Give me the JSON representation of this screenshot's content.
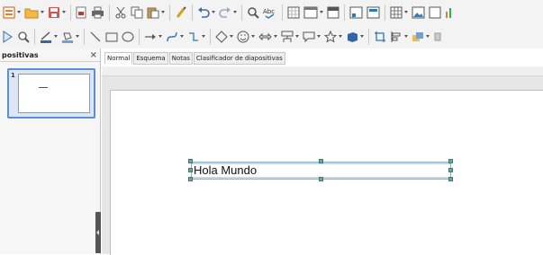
{
  "toolbar1": {
    "icons": [
      "presentation-icon",
      "open-folder-icon",
      "save-icon",
      "export-pdf-icon",
      "print-icon",
      "cut-icon",
      "copy-icon",
      "paste-icon",
      "clone-formatting-icon",
      "undo-icon",
      "redo-icon",
      "find-replace-icon",
      "spelling-icon",
      "grid-icon",
      "slide-layout-icon",
      "master-slide-icon",
      "display-views-icon",
      "table-icon",
      "image-icon",
      "media-icon"
    ]
  },
  "toolbar2": {
    "icons": [
      "sidebar-icon",
      "zoom-icon",
      "line-color-icon",
      "fill-color-icon",
      "line-icon",
      "rectangle-icon",
      "ellipse-icon",
      "arrow-icon",
      "curve-icon",
      "connector-icon",
      "basic-shapes-icon",
      "symbol-shapes-icon",
      "block-arrows-icon",
      "flowchart-icon",
      "callouts-icon",
      "stars-icon",
      "3d-objects-icon",
      "crop-icon",
      "align-icon",
      "arrange-icon"
    ]
  },
  "slides_pane": {
    "title": "positivas",
    "close": "×",
    "slides": [
      {
        "number": "1"
      }
    ]
  },
  "view_tabs": [
    {
      "label": "Normal",
      "active": true
    },
    {
      "label": "Esquema",
      "active": false
    },
    {
      "label": "Notas",
      "active": false
    },
    {
      "label": "Clasificador de diapositivas",
      "active": false
    }
  ],
  "slide": {
    "textbox_text": "Hola Mundo"
  },
  "colors": {
    "selection_accent": "#5b8fd1",
    "handle_green": "#6da89a",
    "canvas_bg": "#e6e6e6"
  }
}
